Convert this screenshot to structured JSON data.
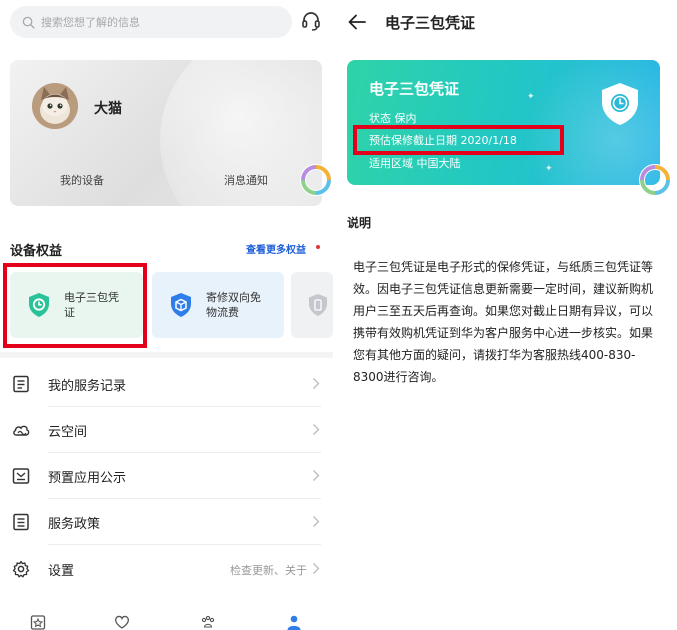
{
  "left_screen": {
    "search": {
      "placeholder": "搜索您想了解的信息",
      "icon": "search-icon",
      "support_icon": "headset-icon"
    },
    "profile": {
      "name": "大猫",
      "devices_label": "我的设备",
      "notifications_label": "消息通知"
    },
    "benefits": {
      "title": "设备权益",
      "more_label": "查看更多权益",
      "items": [
        {
          "label": "电子三包凭证",
          "icon": "shield-clock-icon",
          "color": "#2bc29a"
        },
        {
          "label": "寄修双向免物流费",
          "icon": "shield-box-icon",
          "color": "#2f7de8"
        }
      ]
    },
    "menu": [
      {
        "label": "我的服务记录",
        "icon": "service-record-icon"
      },
      {
        "label": "云空间",
        "icon": "cloud-icon"
      },
      {
        "label": "预置应用公示",
        "icon": "preinstalled-apps-icon"
      },
      {
        "label": "服务政策",
        "icon": "policy-icon"
      },
      {
        "label": "设置",
        "icon": "settings-icon",
        "extra": "检查更新、关于"
      }
    ],
    "tabbar": [
      "home-tab-icon",
      "heart-tab-icon",
      "paw-tab-icon",
      "me-tab-icon"
    ]
  },
  "right_screen": {
    "title": "电子三包凭证",
    "card": {
      "title": "电子三包凭证",
      "status": "状态 保内",
      "date": "预估保修截止日期 2020/1/18",
      "region": "适用区域 中国大陆"
    },
    "note_title": "说明",
    "note_body": "电子三包凭证是电子形式的保修凭证，与纸质三包凭证等效。因电子三包凭证信息更新需要一定时间，建议新购机用户三至五天后再查询。如果您对截止日期有异议，可以携带有效购机凭证到华为客户服务中心进一步核实。如果您有其他方面的疑问，请拨打华为客服热线400-830-8300进行咨询。"
  },
  "colors": {
    "highlight_box": "#e4001a",
    "link_blue": "#1f5fd8",
    "card_gradient_start": "#2fd3a8",
    "card_gradient_end": "#27b6e6"
  }
}
